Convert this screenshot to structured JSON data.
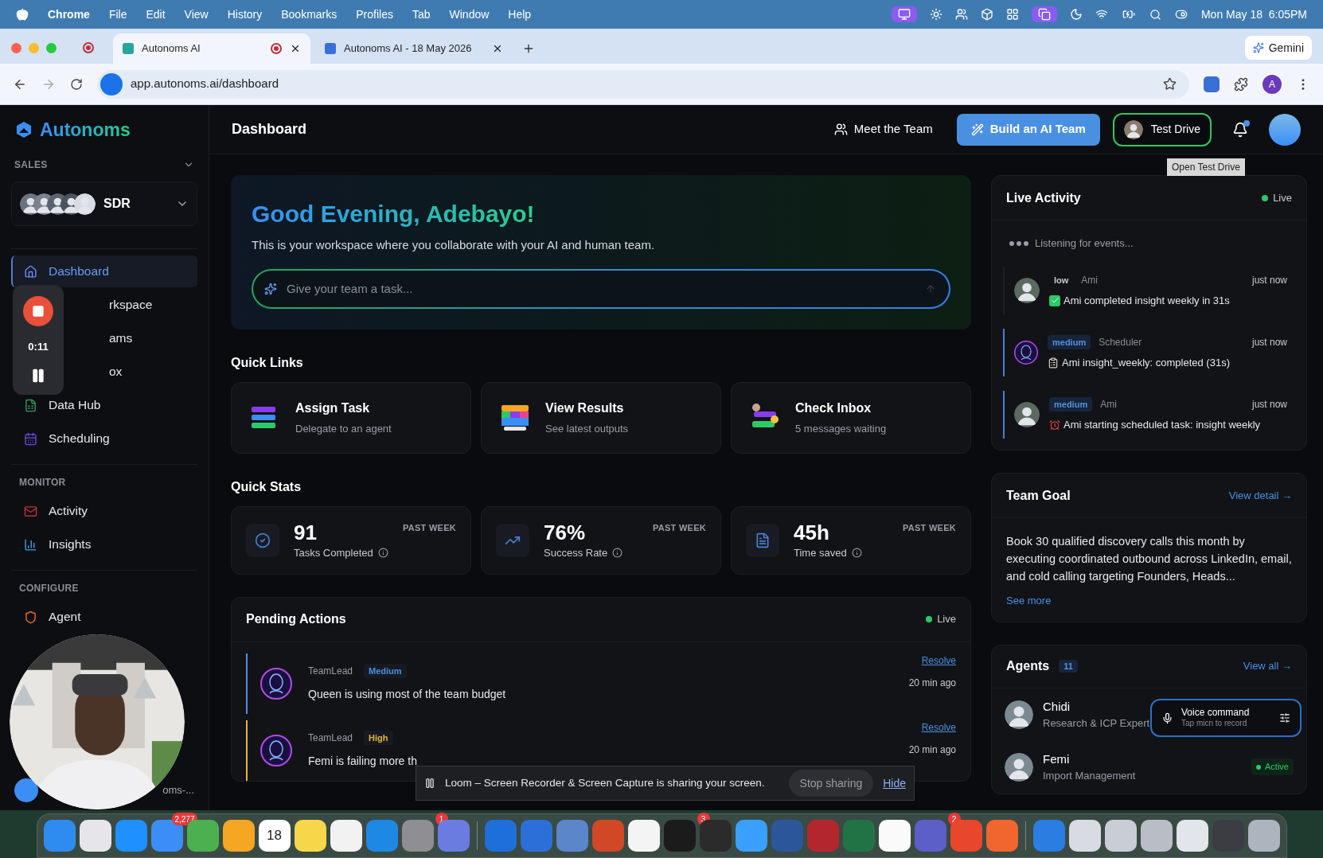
{
  "menubar": {
    "app": "Chrome",
    "menus": [
      "File",
      "Edit",
      "View",
      "History",
      "Bookmarks",
      "Profiles",
      "Tab",
      "Window",
      "Help"
    ],
    "clock": "Mon May 18  6:05PM"
  },
  "browser": {
    "tabs": [
      {
        "title": "Autonoms AI",
        "selected": true,
        "recording": true
      },
      {
        "title": "Autonoms AI - 18 May 2026",
        "selected": false,
        "recording": false
      }
    ],
    "gemini": "Gemini",
    "url": "app.autonoms.ai/dashboard",
    "profile": "A"
  },
  "sidebar": {
    "brand": "Autonoms",
    "section": "SALES",
    "team": "SDR",
    "groups": [
      {
        "items": [
          {
            "label": "Dashboard",
            "kind": "home",
            "selected": true
          },
          {
            "label": "rkspace",
            "kind": "covered",
            "selected": false
          },
          {
            "label": "ams",
            "kind": "covered",
            "selected": false
          },
          {
            "label": "ox",
            "kind": "covered",
            "selected": false
          },
          {
            "label": "Data Hub",
            "kind": "sheet",
            "selected": false
          },
          {
            "label": "Scheduling",
            "kind": "calendar",
            "selected": false
          }
        ]
      },
      {
        "title": "MONITOR",
        "items": [
          {
            "label": "Activity",
            "kind": "mail",
            "selected": false
          },
          {
            "label": "Insights",
            "kind": "bars",
            "selected": false
          }
        ]
      },
      {
        "title": "CONFIGURE",
        "items": [
          {
            "label": "Agent",
            "kind": "shield",
            "selected": false
          }
        ]
      }
    ],
    "footer": "oms-..."
  },
  "header": {
    "title": "Dashboard",
    "meet": "Meet the Team",
    "build": "Build an AI Team",
    "test_drive": "Test Drive",
    "tooltip": "Open Test Drive",
    "unread": true
  },
  "greeting": {
    "title": "Good Evening, Adebayo!",
    "subtitle": "This is your workspace where you collaborate with your AI and human team.",
    "placeholder": "Give your team a task..."
  },
  "quick_links": {
    "title": "Quick Links",
    "items": [
      {
        "title": "Assign Task",
        "subtitle": "Delegate to an agent",
        "kind": "bars"
      },
      {
        "title": "View Results",
        "subtitle": "See latest outputs",
        "kind": "grid"
      },
      {
        "title": "Check Inbox",
        "subtitle": "5 messages waiting",
        "kind": "chat"
      }
    ]
  },
  "quick_stats": {
    "title": "Quick Stats",
    "items": [
      {
        "value": "91",
        "label": "Tasks Completed",
        "period": "PAST WEEK",
        "kind": "check"
      },
      {
        "value": "76%",
        "label": "Success Rate",
        "period": "PAST WEEK",
        "kind": "trend"
      },
      {
        "value": "45h",
        "label": "Time saved",
        "period": "PAST WEEK",
        "kind": "doc"
      }
    ]
  },
  "pending": {
    "title": "Pending Actions",
    "live": "Live",
    "items": [
      {
        "source": "TeamLead",
        "priority": "Medium",
        "color": "#4a90e2",
        "text": "Queen is using most of the team budget",
        "action": "Resolve",
        "time": "20 min ago"
      },
      {
        "source": "TeamLead",
        "priority": "High",
        "color": "#e5b533",
        "text": "Femi is failing more th",
        "action": "Resolve",
        "time": "20 min ago"
      }
    ]
  },
  "live_activity": {
    "title": "Live Activity",
    "live": "Live",
    "listening": "Listening for events...",
    "events": [
      {
        "level": "low",
        "source": "Ami",
        "time": "just now",
        "text": "Ami completed insight weekly in 31s",
        "kind": "check",
        "highlighted": false
      },
      {
        "level": "medium",
        "source": "Scheduler",
        "time": "just now",
        "text": "Ami insight_weekly: completed (31s)",
        "kind": "clipboard",
        "highlighted": true
      },
      {
        "level": "medium",
        "source": "Ami",
        "time": "just now",
        "text": "Ami starting scheduled task: insight weekly",
        "kind": "alarm",
        "highlighted": true
      }
    ]
  },
  "team_goal": {
    "title": "Team Goal",
    "link": "View detail →",
    "text": "Book 30 qualified discovery calls this month by executing coordinated outbound across LinkedIn, email, and cold calling targeting Founders, Heads...",
    "more": "See more"
  },
  "agents": {
    "title": "Agents",
    "count": "11",
    "link": "View all →",
    "items": [
      {
        "name": "Chidi",
        "role": "Research & ICP Expert"
      },
      {
        "name": "Femi",
        "role": "Import Management",
        "status": "Active"
      }
    ]
  },
  "voice": {
    "title": "Voice command",
    "hint": "Tap micn to record"
  },
  "recorder": {
    "time": "0:11"
  },
  "share_bar": {
    "text": "Loom – Screen Recorder & Screen Capture is sharing your screen.",
    "stop": "Stop sharing",
    "hide": "Hide"
  },
  "dock": {
    "items": [
      {
        "color": "#2e8cf0"
      },
      {
        "color": "#e6e6ea"
      },
      {
        "color": "#1e90ff"
      },
      {
        "color": "#3a8ef6",
        "badge": "2,277"
      },
      {
        "color": "#4caf50"
      },
      {
        "color": "#f5a623"
      },
      {
        "color": "#ffffff",
        "label": "18"
      },
      {
        "color": "#f7d64a"
      },
      {
        "color": "#f2f2f2"
      },
      {
        "color": "#1e88e5"
      },
      {
        "color": "#8e8e93",
        "badge": "1"
      },
      {
        "color": "#6b7ce0"
      },
      {
        "color": "#1e6fd9",
        "divider": true
      },
      {
        "color": "#2d6fd8"
      },
      {
        "color": "#5b86c9"
      },
      {
        "color": "#d24726"
      },
      {
        "color": "#f4f4f4"
      },
      {
        "color": "#1b1b1b",
        "badge": "3"
      },
      {
        "color": "#2b2b2b"
      },
      {
        "color": "#3aa0ff"
      },
      {
        "color": "#2b579a"
      },
      {
        "color": "#b3262e"
      },
      {
        "color": "#217346"
      },
      {
        "color": "#fafafa"
      },
      {
        "color": "#5b5fc7",
        "badge": "2"
      },
      {
        "color": "#e8472b"
      },
      {
        "color": "#f0662e"
      },
      {
        "color": "#2a7de1",
        "divider": true
      },
      {
        "color": "#d8dce2"
      },
      {
        "color": "#c9ced6"
      },
      {
        "color": "#b9bec6"
      },
      {
        "color": "#e2e5ea"
      },
      {
        "color": "#3b3d42"
      },
      {
        "color": "#aeb4bd"
      }
    ]
  }
}
